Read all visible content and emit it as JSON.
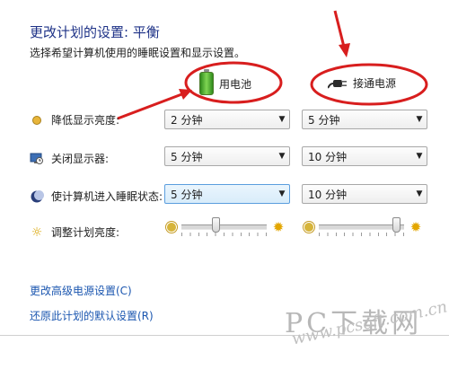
{
  "page": {
    "title": "更改计划的设置: 平衡",
    "subtitle": "选择希望计算机使用的睡眠设置和显示设置。"
  },
  "columns": {
    "battery": "用电池",
    "plugged": "接通电源"
  },
  "rows": [
    {
      "label": "降低显示亮度:",
      "icon": "dim-brightness-icon",
      "battery": "2 分钟",
      "plugged": "5 分钟"
    },
    {
      "label": "关闭显示器:",
      "icon": "monitor-icon",
      "battery": "5 分钟",
      "plugged": "10 分钟"
    },
    {
      "label": "使计算机进入睡眠状态:",
      "icon": "moon-icon",
      "battery": "5 分钟",
      "plugged": "10 分钟"
    }
  ],
  "brightness": {
    "label": "调整计划亮度:",
    "battery_level_pct": 40,
    "plugged_level_pct": 95
  },
  "links": {
    "advanced": "更改高级电源设置(C)",
    "restore": "还原此计划的默认设置(R)"
  },
  "watermark": {
    "main": "PC下载网",
    "url": "www.pcsoft.com.cn"
  },
  "colors": {
    "title": "#1e3287",
    "link": "#1c57b0",
    "annotation": "#d81e1e"
  }
}
